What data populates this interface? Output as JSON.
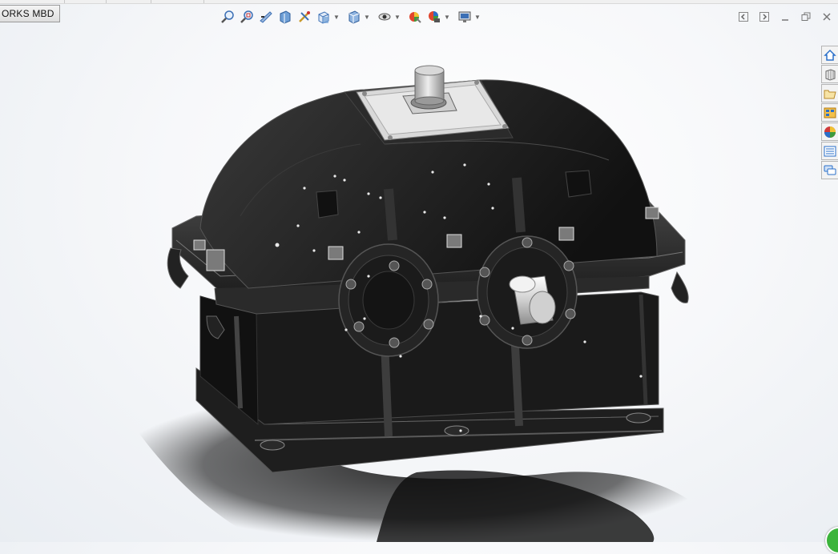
{
  "app": {
    "tab_label": "ORKS MBD"
  },
  "heads_up_toolbar": {
    "buttons": [
      {
        "name": "zoom-to-fit-icon"
      },
      {
        "name": "zoom-to-area-icon"
      },
      {
        "name": "previous-view-icon"
      },
      {
        "name": "section-view-icon"
      },
      {
        "name": "dynamic-annotation-views-icon"
      },
      {
        "name": "view-orientation-icon",
        "dropdown": true
      },
      {
        "name": "display-style-icon",
        "dropdown": true
      },
      {
        "name": "hide-show-items-icon",
        "dropdown": true
      },
      {
        "name": "edit-appearance-icon"
      },
      {
        "name": "apply-scene-icon",
        "dropdown": true
      },
      {
        "name": "view-settings-icon",
        "dropdown": true
      }
    ]
  },
  "window_controls": [
    "tile-left-icon",
    "tile-right-icon",
    "minimize-icon",
    "restore-icon",
    "close-icon"
  ],
  "task_pane": {
    "items": [
      {
        "name": "solidworks-resources-icon",
        "color": "#2a6fc9"
      },
      {
        "name": "design-library-icon",
        "color": "#777777"
      },
      {
        "name": "file-explorer-icon",
        "color": "#d4a640"
      },
      {
        "name": "view-palette-icon",
        "color": "#d48a20"
      },
      {
        "name": "appearances-scenes-decals-icon",
        "color": "#d03a3a"
      },
      {
        "name": "custom-properties-icon",
        "color": "#2a6fc9"
      },
      {
        "name": "solidworks-forum-icon",
        "color": "#2a6fc9"
      }
    ]
  },
  "model": {
    "name": "gear-reducer-housing",
    "body_color": "#1c1c1c",
    "accent_color": "#c8c8c8"
  }
}
